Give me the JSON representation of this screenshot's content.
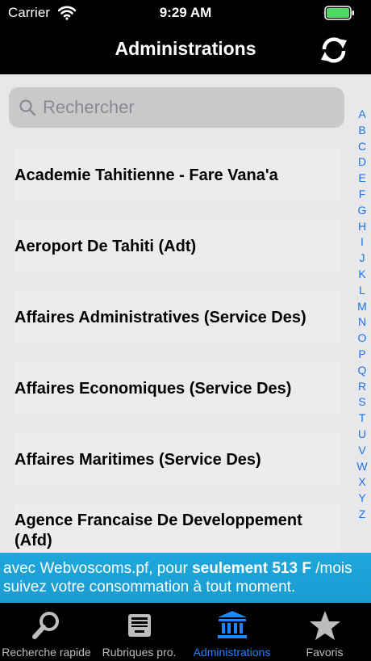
{
  "status_bar": {
    "carrier": "Carrier",
    "time": "9:29 AM"
  },
  "nav": {
    "title": "Administrations"
  },
  "search": {
    "placeholder": "Rechercher"
  },
  "list": {
    "items": [
      {
        "label": "Academie Tahitienne - Fare Vana'a"
      },
      {
        "label": "Aeroport De Tahiti (Adt)"
      },
      {
        "label": "Affaires Administratives (Service Des)"
      },
      {
        "label": "Affaires Economiques (Service Des)"
      },
      {
        "label": "Affaires Maritimes (Service Des)"
      },
      {
        "label": "Agence Francaise De Developpement (Afd)"
      }
    ]
  },
  "index": [
    "A",
    "B",
    "C",
    "D",
    "E",
    "F",
    "G",
    "H",
    "I",
    "J",
    "K",
    "L",
    "M",
    "N",
    "O",
    "P",
    "Q",
    "R",
    "S",
    "T",
    "U",
    "V",
    "W",
    "X",
    "Y",
    "Z"
  ],
  "ad": {
    "line1_a": "avec Webvoscoms.pf, pour ",
    "line1_b": "seulement 513 F",
    "line1_c": " /mois",
    "line2": "suivez votre consommation à tout moment."
  },
  "tabs": [
    {
      "label": "Recherche rapide",
      "icon": "magnifier-icon",
      "active": false
    },
    {
      "label": "Rubriques pro.",
      "icon": "inbox-tray-icon",
      "active": false
    },
    {
      "label": "Administrations",
      "icon": "building-icon",
      "active": true
    },
    {
      "label": "Favoris",
      "icon": "star-icon",
      "active": false
    }
  ],
  "colors": {
    "accent": "#1f84ff",
    "index_letters": "#1a73e8",
    "ad_background": "#1ea8dc",
    "bars": "#000000"
  }
}
